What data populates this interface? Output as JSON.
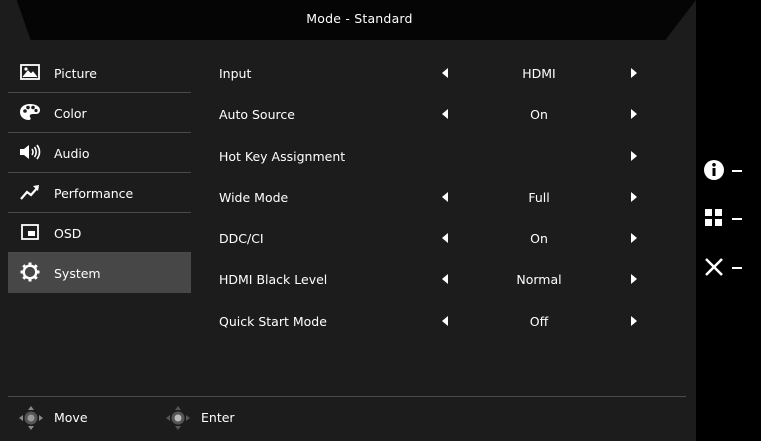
{
  "header": {
    "title": "Mode - Standard"
  },
  "sidebar": {
    "items": [
      {
        "label": "Picture",
        "icon": "picture-icon"
      },
      {
        "label": "Color",
        "icon": "palette-icon"
      },
      {
        "label": "Audio",
        "icon": "speaker-icon"
      },
      {
        "label": "Performance",
        "icon": "trend-arrow-icon"
      },
      {
        "label": "OSD",
        "icon": "osd-window-icon"
      },
      {
        "label": "System",
        "icon": "gear-icon",
        "active": true
      }
    ]
  },
  "settings": {
    "rows": [
      {
        "label": "Input",
        "value": "HDMI"
      },
      {
        "label": "Auto Source",
        "value": "On"
      },
      {
        "label": "Hot Key Assignment",
        "value": ""
      },
      {
        "label": "Wide Mode",
        "value": "Full"
      },
      {
        "label": "DDC/CI",
        "value": "On"
      },
      {
        "label": "HDMI Black Level",
        "value": "Normal"
      },
      {
        "label": "Quick Start Mode",
        "value": "Off"
      }
    ]
  },
  "footer": {
    "move_label": "Move",
    "enter_label": "Enter"
  },
  "hotkeys": [
    {
      "icon": "info-icon"
    },
    {
      "icon": "menu-grid-icon"
    },
    {
      "icon": "close-icon"
    }
  ],
  "colors": {
    "panel": "#1c1c1c",
    "selected": "#474747",
    "divider": "#4a4a4a",
    "text": "#ffffff"
  }
}
